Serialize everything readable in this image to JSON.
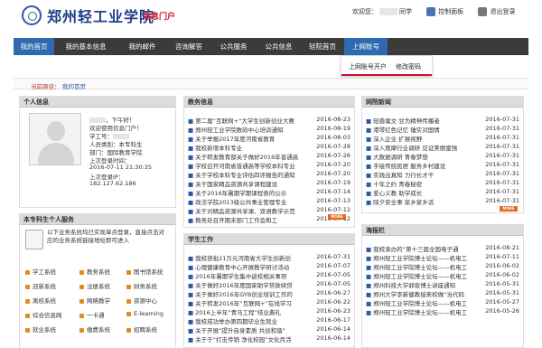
{
  "header": {
    "school_name": "郑州轻工业学院",
    "portal_tag": "信息门户",
    "welcome": "欢迎您：",
    "user_suffix": "同学",
    "control_panel": "控制面板",
    "logout": "退出登录"
  },
  "nav": [
    {
      "label": "我的首页",
      "active": true
    },
    {
      "label": "我的基本信息"
    },
    {
      "label": "我的邮件"
    },
    {
      "label": "咨询解答"
    },
    {
      "label": "公共服务"
    },
    {
      "label": "公共信息"
    },
    {
      "label": "轻院首页"
    },
    {
      "label": "上网账号"
    }
  ],
  "dropdown": {
    "items": [
      "上网账号开户",
      "修改密码"
    ]
  },
  "breadcrumb": {
    "label": "当前路径：",
    "home": "我的首页"
  },
  "personal": {
    "title": "个人信息",
    "greeting": "，下午好！",
    "welcome": "欢迎使用信息门户！",
    "student_id_label": "学工号：",
    "person_type": "人员类别：本专科生",
    "dept_label": "部门：",
    "dept_value": "国际教育学院",
    "last_login_time_label": "上次登录时间：",
    "last_login_time": "2016-07-11 21:30:35",
    "last_login_ip_label": "上次登录IP：",
    "last_login_ip": "182.127.62.186"
  },
  "services": {
    "title": "本专科生个人服务",
    "note": "以下业务系统均已实现单点登录，直接点击对应的业务系统链接地址即可进入",
    "items": [
      "学工系统",
      "教务系统",
      "图书馆系统",
      "迎新系统",
      "注册系统",
      "财务系统",
      "离校系统",
      "网络教学",
      "资源中心",
      "综合信息网",
      "一卡通",
      "E-learning",
      "就业系统",
      "缴费系统",
      "招聘系统"
    ]
  },
  "edu_news": {
    "title": "教务信息",
    "more": "MORE",
    "items": [
      {
        "text": "第二届“互联网+”大学生创新创业大赛",
        "date": "2016-08-23"
      },
      {
        "text": "郑州轻工业学院数码中心培训通知",
        "date": "2016-08-19"
      },
      {
        "text": "关于举报2017年度河南省教育",
        "date": "2016-08-03"
      },
      {
        "text": "我校新增本科专业",
        "date": "2016-07-28"
      },
      {
        "text": "关于转发教育部关于做好2016年普通高",
        "date": "2016-07-26"
      },
      {
        "text": "学校召开河南省普通高等学校本科专业",
        "date": "2016-07-20"
      },
      {
        "text": "关于学校本科专业评估四评报告的通知",
        "date": "2016-07-20"
      },
      {
        "text": "关于国家精品资源共享课程建设",
        "date": "2016-07-19"
      },
      {
        "text": "关于2016年暑期学期课程表的公示",
        "date": "2016-07-14"
      },
      {
        "text": "政法学院2013级公共事业管理专业",
        "date": "2016-07-13"
      },
      {
        "text": "关于对精品资源共享课、双语教学示范",
        "date": "2016-07-12"
      },
      {
        "text": "教务处召开期末部门工作会和工",
        "date": "2016-07-12"
      }
    ]
  },
  "student_work": {
    "title": "学生工作",
    "items": [
      {
        "text": "我校获批21万元河南省大学生创新创",
        "date": "2016-07-31"
      },
      {
        "text": "心理健康教育中心开展教学研讨活动",
        "date": "2016-07-07"
      },
      {
        "text": "2016年暑期学生集中返校相关事项",
        "date": "2016-07-05"
      },
      {
        "text": "关于做好2016年度国家助学贷款续贷",
        "date": "2016-07-05"
      },
      {
        "text": "关于做好2016年GYB创业培训工作的",
        "date": "2016-06-27"
      },
      {
        "text": "关于转发2016年“互联网+”在线学习",
        "date": "2016-06-22"
      },
      {
        "text": "2016上半年“青马工程”结业典礼",
        "date": "2016-06-23"
      },
      {
        "text": "我校成功举办第四期毕业生就业",
        "date": "2016-06-17"
      },
      {
        "text": "关于开展“提升自身素质 共创和谐”",
        "date": "2016-06-14"
      },
      {
        "text": "关于于“打击传销 净化校园”文化月活",
        "date": "2016-06-14"
      }
    ]
  },
  "campus_news": {
    "title": "网院新闻",
    "more": "MORE",
    "items": [
      {
        "text": "轻盾毫文 甘为精神传播者",
        "date": "2016-07-31"
      },
      {
        "text": "港琴红色记忆 锤实对国情",
        "date": "2016-07-31"
      },
      {
        "text": "深入企业 扩展视野",
        "date": "2016-07-31"
      },
      {
        "text": "深入观摩行业调研 见证美丽富强",
        "date": "2016-07-31"
      },
      {
        "text": "大数据调研 青春梦想",
        "date": "2016-07-31"
      },
      {
        "text": "手绘传统民居 服务乡村建设",
        "date": "2016-07-31"
      },
      {
        "text": "实践出真知 力行长才干",
        "date": "2016-07-31"
      },
      {
        "text": "十年之约 青春秘密",
        "date": "2016-07-31"
      },
      {
        "text": "爱心义教 助学成长",
        "date": "2016-07-31"
      },
      {
        "text": "除夕安全事 家乡家乡话",
        "date": "2016-07-31"
      }
    ]
  },
  "posters": {
    "title": "海报栏",
    "items": [
      {
        "text": "我校承办的“第十三届全国电子通",
        "date": "2016-08-21"
      },
      {
        "text": "郑州轻工业学院博士论坛——机电工",
        "date": "2016-07-11"
      },
      {
        "text": "郑州轻工业学院博士论坛——机电工",
        "date": "2016-06-02"
      },
      {
        "text": "郑州轻工业学院博士论坛——机电工",
        "date": "2016-06-02"
      },
      {
        "text": "郑州科技大学郭俊博士讲座通知",
        "date": "2016-05-31"
      },
      {
        "text": "郑州大学李新健教授来校做“当代码",
        "date": "2016-05-31"
      },
      {
        "text": "郑州轻工业学院博士论坛——机电工",
        "date": "2016-05-27"
      },
      {
        "text": "郑州轻工业学院博士论坛——机电工",
        "date": "2016-05-26"
      }
    ]
  }
}
